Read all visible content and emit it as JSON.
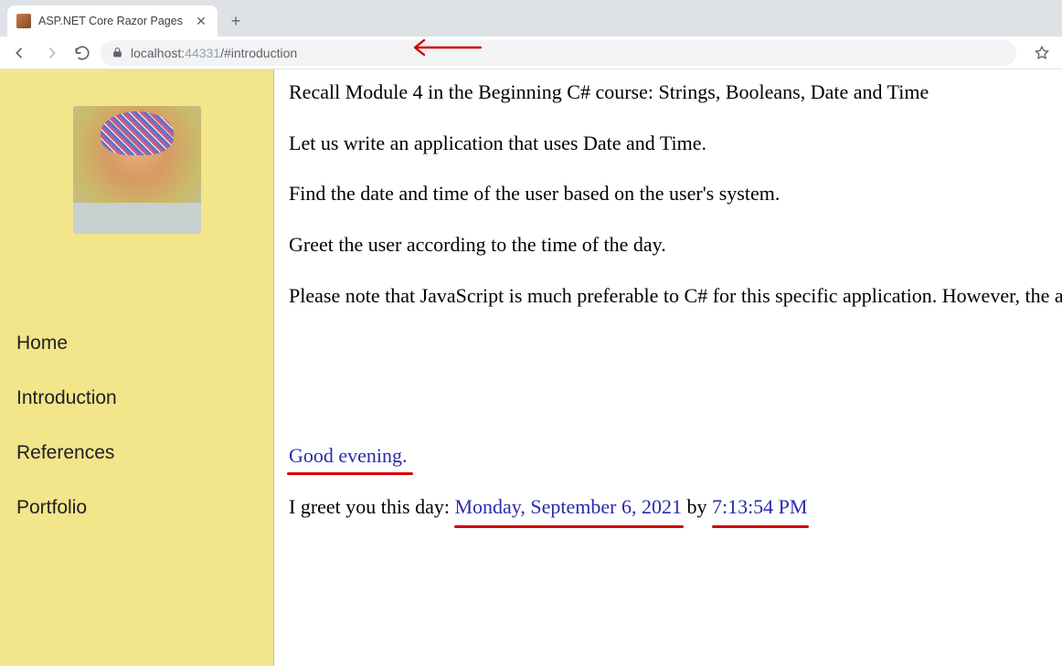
{
  "browser": {
    "tab_title": "ASP.NET Core Razor Pages",
    "url_host": "localhost:",
    "url_port": "44331",
    "url_hash": "/#introduction"
  },
  "sidebar": {
    "items": [
      {
        "label": "Home"
      },
      {
        "label": "Introduction"
      },
      {
        "label": "References"
      },
      {
        "label": "Portfolio"
      }
    ]
  },
  "content": {
    "p1": "Recall Module 4 in the Beginning C# course: Strings, Booleans, Date and Time",
    "p2": "Let us write an application that uses Date and Time.",
    "p3": "Find the date and time of the user based on the user's system.",
    "p4": "Greet the user according to the time of the day.",
    "p5": "Please note that JavaScript is much preferable to C# for this specific application. However, the aim is to gradually introduce you to the Razor syntax.",
    "greeting": "Good evening.",
    "greet_prefix": "I greet you this day: ",
    "date": "Monday, September 6, 2021",
    "by": " by ",
    "time": "7:13:54 PM"
  }
}
